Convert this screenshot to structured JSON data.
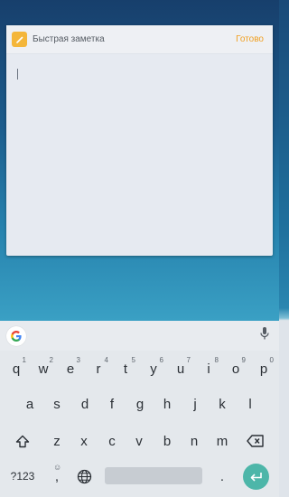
{
  "note": {
    "title": "Быстрая заметка",
    "done_label": "Готово"
  },
  "keyboard": {
    "row1": [
      {
        "label": "q",
        "hint": "1"
      },
      {
        "label": "w",
        "hint": "2"
      },
      {
        "label": "e",
        "hint": "3"
      },
      {
        "label": "r",
        "hint": "4"
      },
      {
        "label": "t",
        "hint": "5"
      },
      {
        "label": "y",
        "hint": "6"
      },
      {
        "label": "u",
        "hint": "7"
      },
      {
        "label": "i",
        "hint": "8"
      },
      {
        "label": "o",
        "hint": "9"
      },
      {
        "label": "p",
        "hint": "0"
      }
    ],
    "row2": [
      "a",
      "s",
      "d",
      "f",
      "g",
      "h",
      "j",
      "k",
      "l"
    ],
    "row3": [
      "z",
      "x",
      "c",
      "v",
      "b",
      "n",
      "m"
    ],
    "symbols_label": "?123",
    "comma_label": ",",
    "emoji_hint": "☺",
    "period_label": ".",
    "icons": {
      "google": "google-icon",
      "mic": "microphone-icon",
      "shift": "shift-icon",
      "backspace": "backspace-icon",
      "globe": "globe-icon",
      "enter": "enter-icon"
    },
    "accent": "#4db6a9"
  },
  "colors": {
    "done": "#f0a023",
    "note_icon": "#f4b63a"
  }
}
